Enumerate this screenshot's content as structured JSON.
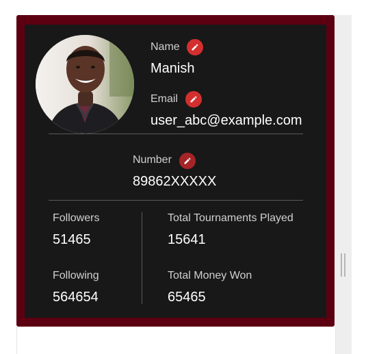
{
  "profile": {
    "name_label": "Name",
    "name_value": "Manish",
    "email_label": "Email",
    "email_value": "user_abc@example.com",
    "number_label": "Number",
    "number_value": "89862XXXXX"
  },
  "stats": {
    "followers_label": "Followers",
    "followers_value": "51465",
    "following_label": "Following",
    "following_value": "564654",
    "tournaments_label": "Total Tournaments Played",
    "tournaments_value": "15641",
    "money_label": "Total Money Won",
    "money_value": "65465"
  },
  "icons": {
    "edit": "pencil-icon"
  },
  "colors": {
    "card_border": "#5c0011",
    "card_background": "#181818",
    "edit_button": "#d32f2f",
    "edit_button_dark": "#a52428"
  }
}
